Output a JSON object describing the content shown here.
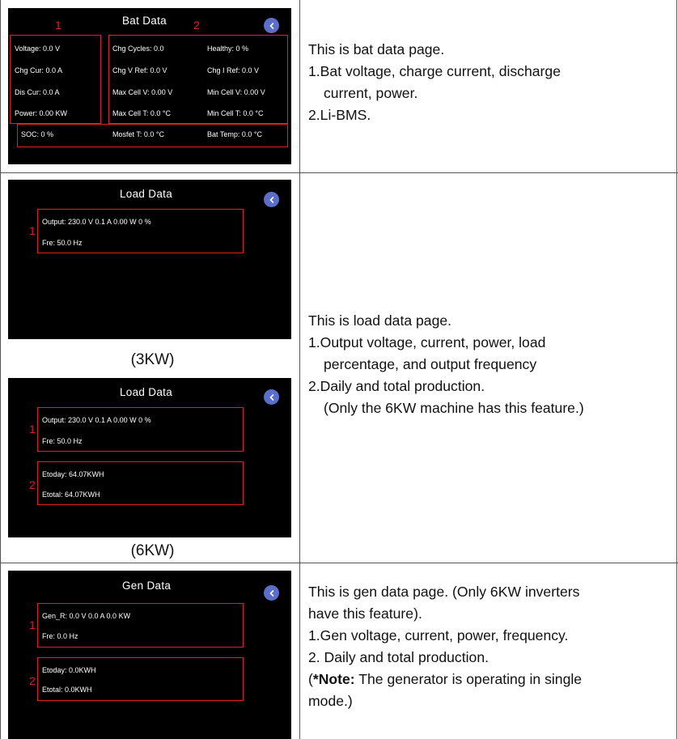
{
  "bat": {
    "title": "Bat Data",
    "labels": {
      "one": "1",
      "two": "2"
    },
    "col1": {
      "voltage": "Voltage:  0.0  V",
      "chg_cur": "Chg Cur:  0.0  A",
      "dis_cur": "Dis Cur:  0.0  A",
      "power": "Power:    0.00  KW"
    },
    "col2": {
      "chg_cycles": "Chg Cycles: 0.0",
      "chg_v_ref": "Chg V Ref:  0.0  V",
      "max_cell_v": "Max Cell V: 0.00  V",
      "max_cell_t": "Max Cell T:  0.0  °C"
    },
    "col3": {
      "healthy": "Healthy:    0  %",
      "chg_i_ref": "Chg I Ref:  0.0  V",
      "min_cell_v": "Min Cell V: 0.00  V",
      "min_cell_t": "Min Cell T:  0.0  °C"
    },
    "bottom": {
      "soc": "SOC:      0  %",
      "mosfet_t": "Mosfet T:    0.0  °C",
      "bat_temp": "Bat Temp:  0.0  °C"
    },
    "description": [
      "This is bat data page.",
      "1.Bat voltage, charge current, discharge",
      "current, power.",
      "2.Li-BMS."
    ]
  },
  "load3": {
    "title": "Load Data",
    "label_one": "1",
    "output": "Output:  230.0  V        0.1  A          0.00  W   0  %",
    "fre": "Fre:        50.0  Hz",
    "caption": "(3KW)"
  },
  "load6": {
    "title": "Load Data",
    "label_one": "1",
    "label_two": "2",
    "output": "Output:  230.0  V        0.1  A          0.00  W   0  %",
    "fre": "Fre:        50.0  Hz",
    "etoday": "Etoday:  64.07KWH",
    "etotal": "Etotal:    64.07KWH",
    "caption": "(6KW)"
  },
  "load_description": [
    "This is load data page.",
    "1.Output voltage, current, power, load",
    "percentage, and output frequency",
    "2.Daily and total production.",
    "(Only the 6KW machine has this feature.)"
  ],
  "gen": {
    "title": "Gen Data",
    "label_one": "1",
    "label_two": "2",
    "gen_r": "Gen_R:  0.0  V           0.0  A           0.0  KW",
    "fre": "Fre:        0.0  Hz",
    "etoday": "Etoday:  0.0KWH",
    "etotal": "Etotal:    0.0KWH",
    "description": [
      "This is gen data page. (Only 6KW inverters",
      "have this feature).",
      "1.Gen voltage, current, power, frequency.",
      "2. Daily and total production."
    ],
    "note_prefix": "(",
    "note_bold": "*Note:",
    "note_rest": " The generator is operating in single",
    "note_line2": "mode.)"
  },
  "icons": {
    "back": "chevron-left-icon"
  },
  "colors": {
    "screen_bg": "#000000",
    "highlight": "#e02020",
    "back_button": "#5b6ec9"
  }
}
